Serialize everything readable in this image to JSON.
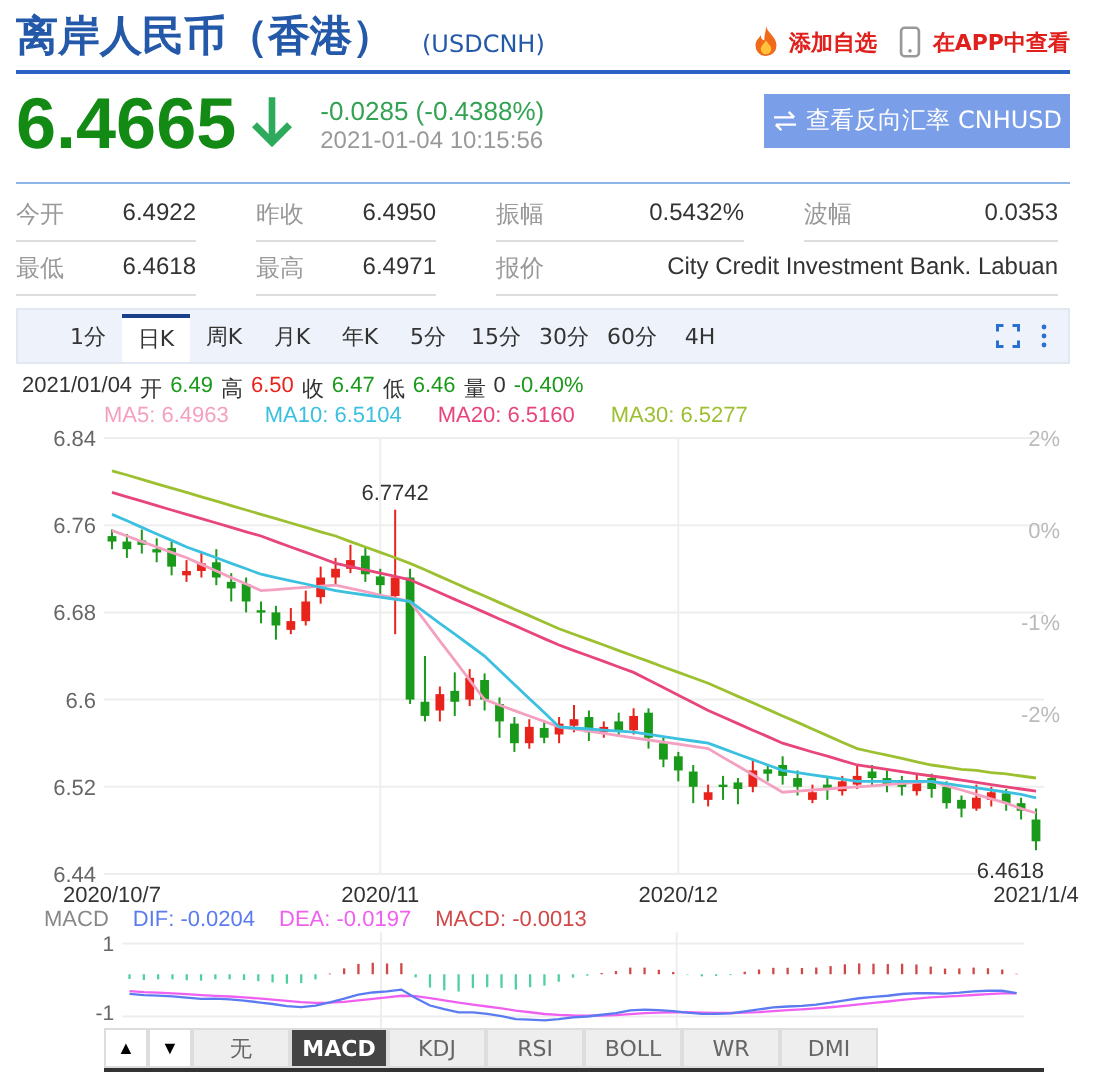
{
  "header": {
    "title": "离岸人民币（香港）",
    "code": "(USDCNH)",
    "actions": [
      {
        "kind": "watch",
        "label": "添加自选"
      },
      {
        "kind": "app",
        "label": "在APP中查看"
      }
    ]
  },
  "quote": {
    "price": "6.4665",
    "falling": true,
    "change": "-0.0285 (-0.4388%)",
    "time": "2021-01-04 10:15:56",
    "reverse_button": "查看反向汇率 CNHUSD"
  },
  "stats": [
    [
      {
        "label": "今开",
        "value": "6.4922"
      },
      {
        "label": "昨收",
        "value": "6.4950"
      },
      {
        "label": "振幅",
        "value": "0.5432%"
      },
      {
        "label": "波幅",
        "value": "0.0353"
      }
    ],
    [
      {
        "label": "最低",
        "value": "6.4618"
      },
      {
        "label": "最高",
        "value": "6.4971"
      },
      {
        "label": "报价",
        "value": "City Credit Investment Bank. Labuan"
      }
    ]
  ],
  "periods": [
    {
      "label": "1分",
      "selected": false
    },
    {
      "label": "日K",
      "selected": true
    },
    {
      "label": "周K",
      "selected": false
    },
    {
      "label": "月K",
      "selected": false
    },
    {
      "label": "年K",
      "selected": false
    },
    {
      "label": "5分",
      "selected": false
    },
    {
      "label": "15分",
      "selected": false
    },
    {
      "label": "30分",
      "selected": false
    },
    {
      "label": "60分",
      "selected": false
    },
    {
      "label": "4H",
      "selected": false
    }
  ],
  "ohlc": {
    "date": "2021/01/04",
    "fields": [
      {
        "label": "开",
        "value": "6.49",
        "color": "#1a9a1a"
      },
      {
        "label": "高",
        "value": "6.50",
        "color": "#e8231b"
      },
      {
        "label": "收",
        "value": "6.47",
        "color": "#1a9a1a"
      },
      {
        "label": "低",
        "value": "6.46",
        "color": "#1a9a1a"
      },
      {
        "label": "量",
        "value": "0",
        "color": "#333333"
      }
    ],
    "change": {
      "text": "-0.40%",
      "color": "#1a9a1a"
    }
  },
  "ma": [
    {
      "text": "MA5: 6.4963",
      "color": "#f4a0c0"
    },
    {
      "text": "MA10: 6.5104",
      "color": "#3cc0e0"
    },
    {
      "text": "MA20: 6.5160",
      "color": "#e8457a"
    },
    {
      "text": "MA30: 6.5277",
      "color": "#9cc030"
    }
  ],
  "chart": {
    "chart_data": {
      "type": "candlestick",
      "ylim": [
        6.44,
        6.84
      ],
      "yticks": [
        6.84,
        6.76,
        6.68,
        6.6,
        6.52,
        6.44
      ],
      "grid": true,
      "categories": [
        "2020/10/7",
        null,
        null,
        null,
        null,
        null,
        null,
        null,
        null,
        null,
        null,
        null,
        null,
        null,
        null,
        null,
        null,
        null,
        "2020/11",
        null,
        null,
        null,
        null,
        null,
        null,
        null,
        null,
        null,
        null,
        null,
        null,
        null,
        null,
        null,
        null,
        null,
        null,
        null,
        "2020/12",
        null,
        null,
        null,
        null,
        null,
        null,
        null,
        null,
        null,
        null,
        null,
        null,
        null,
        null,
        null,
        null,
        null,
        null,
        null,
        null,
        null,
        null,
        null,
        "2021/1/4"
      ],
      "ohlc": [
        [
          6.75,
          6.756,
          6.738,
          6.745
        ],
        [
          6.745,
          6.752,
          6.73,
          6.738
        ],
        [
          6.746,
          6.756,
          6.734,
          6.742
        ],
        [
          6.738,
          6.748,
          6.726,
          6.735
        ],
        [
          6.739,
          6.745,
          6.714,
          6.722
        ],
        [
          6.714,
          6.728,
          6.708,
          6.718
        ],
        [
          6.718,
          6.735,
          6.712,
          6.725
        ],
        [
          6.726,
          6.738,
          6.705,
          6.712
        ],
        [
          6.708,
          6.716,
          6.69,
          6.702
        ],
        [
          6.706,
          6.712,
          6.68,
          6.69
        ],
        [
          6.682,
          6.69,
          6.67,
          6.68
        ],
        [
          6.68,
          6.686,
          6.655,
          6.668
        ],
        [
          6.664,
          6.684,
          6.66,
          6.672
        ],
        [
          6.672,
          6.7,
          6.668,
          6.69
        ],
        [
          6.694,
          6.722,
          6.688,
          6.712
        ],
        [
          6.712,
          6.73,
          6.705,
          6.72
        ],
        [
          6.72,
          6.742,
          6.716,
          6.728
        ],
        [
          6.732,
          6.74,
          6.708,
          6.715
        ],
        [
          6.713,
          6.72,
          6.695,
          6.705
        ],
        [
          6.695,
          6.7742,
          6.66,
          6.712
        ],
        [
          6.712,
          6.72,
          6.596,
          6.6
        ],
        [
          6.598,
          6.64,
          6.58,
          6.585
        ],
        [
          6.59,
          6.612,
          6.58,
          6.605
        ],
        [
          6.608,
          6.625,
          6.585,
          6.598
        ],
        [
          6.6,
          6.628,
          6.594,
          6.62
        ],
        [
          6.618,
          6.624,
          6.59,
          6.6
        ],
        [
          6.596,
          6.602,
          6.565,
          6.58
        ],
        [
          6.578,
          6.584,
          6.552,
          6.56
        ],
        [
          6.56,
          6.582,
          6.555,
          6.575
        ],
        [
          6.574,
          6.58,
          6.56,
          6.565
        ],
        [
          6.568,
          6.584,
          6.56,
          6.578
        ],
        [
          6.576,
          6.595,
          6.57,
          6.582
        ],
        [
          6.584,
          6.59,
          6.562,
          6.57
        ],
        [
          6.57,
          6.58,
          6.565,
          6.575
        ],
        [
          6.58,
          6.588,
          6.566,
          6.572
        ],
        [
          6.572,
          6.592,
          6.568,
          6.585
        ],
        [
          6.588,
          6.592,
          6.555,
          6.565
        ],
        [
          6.56,
          6.566,
          6.538,
          6.545
        ],
        [
          6.548,
          6.552,
          6.525,
          6.535
        ],
        [
          6.534,
          6.54,
          6.505,
          6.52
        ],
        [
          6.508,
          6.522,
          6.502,
          6.515
        ],
        [
          6.522,
          6.53,
          6.508,
          6.52
        ],
        [
          6.524,
          6.528,
          6.504,
          6.518
        ],
        [
          6.52,
          6.545,
          6.515,
          6.535
        ],
        [
          6.536,
          6.54,
          6.525,
          6.532
        ],
        [
          6.54,
          6.548,
          6.522,
          6.53
        ],
        [
          6.528,
          6.535,
          6.512,
          6.52
        ],
        [
          6.508,
          6.522,
          6.505,
          6.515
        ],
        [
          6.522,
          6.528,
          6.508,
          6.518
        ],
        [
          6.516,
          6.53,
          6.512,
          6.525
        ],
        [
          6.522,
          6.54,
          6.518,
          6.53
        ],
        [
          6.534,
          6.54,
          6.52,
          6.528
        ],
        [
          6.528,
          6.535,
          6.515,
          6.522
        ],
        [
          6.526,
          6.53,
          6.512,
          6.52
        ],
        [
          6.516,
          6.532,
          6.512,
          6.525
        ],
        [
          6.528,
          6.532,
          6.51,
          6.518
        ],
        [
          6.52,
          6.525,
          6.5,
          6.505
        ],
        [
          6.508,
          6.512,
          6.492,
          6.5
        ],
        [
          6.5,
          6.522,
          6.498,
          6.51
        ],
        [
          6.508,
          6.52,
          6.502,
          6.515
        ],
        [
          6.514,
          6.518,
          6.498,
          6.505
        ],
        [
          6.505,
          6.51,
          6.49,
          6.498
        ],
        [
          6.49,
          6.5,
          6.4618,
          6.47
        ]
      ],
      "series": [
        {
          "type": "line",
          "color": "#f4a0c0",
          "values": [
            6.755,
            6.75,
            6.745,
            6.74,
            6.735,
            6.73,
            6.724,
            6.718,
            6.712,
            6.706,
            6.7,
            6.701,
            6.702,
            6.703,
            6.704,
            6.705,
            6.702,
            6.699,
            6.696,
            6.693,
            6.69,
            6.672,
            6.654,
            6.636,
            6.618,
            6.6,
            6.595,
            6.59,
            6.585,
            6.58,
            6.575,
            6.573,
            6.571,
            6.569,
            6.567,
            6.565,
            6.563,
            6.561,
            6.559,
            6.557,
            6.555,
            6.547,
            6.539,
            6.531,
            6.523,
            6.515,
            6.516,
            6.517,
            6.518,
            6.519,
            6.52,
            6.521,
            6.522,
            6.523,
            6.524,
            6.525,
            6.521,
            6.517,
            6.513,
            6.509,
            6.505,
            6.5,
            6.496
          ]
        },
        {
          "type": "line",
          "color": "#3cc0e0",
          "values": [
            6.77,
            6.764,
            6.758,
            6.752,
            6.746,
            6.74,
            6.735,
            6.73,
            6.725,
            6.72,
            6.715,
            6.712,
            6.709,
            6.706,
            6.703,
            6.7,
            6.698,
            6.696,
            6.694,
            6.692,
            6.69,
            6.68,
            6.67,
            6.66,
            6.65,
            6.64,
            6.627,
            6.614,
            6.601,
            6.588,
            6.575,
            6.574,
            6.573,
            6.572,
            6.571,
            6.57,
            6.568,
            6.566,
            6.564,
            6.562,
            6.56,
            6.555,
            6.55,
            6.545,
            6.54,
            6.535,
            6.533,
            6.531,
            6.529,
            6.527,
            6.525,
            6.525,
            6.525,
            6.525,
            6.525,
            6.525,
            6.523,
            6.521,
            6.519,
            6.517,
            6.515,
            6.513,
            6.51
          ]
        },
        {
          "type": "line",
          "color": "#e8457a",
          "values": [
            6.79,
            6.786,
            6.782,
            6.778,
            6.774,
            6.77,
            6.766,
            6.762,
            6.758,
            6.754,
            6.75,
            6.745,
            6.74,
            6.735,
            6.73,
            6.725,
            6.722,
            6.719,
            6.716,
            6.713,
            6.71,
            6.704,
            6.698,
            6.692,
            6.686,
            6.68,
            6.674,
            6.668,
            6.662,
            6.656,
            6.65,
            6.645,
            6.64,
            6.635,
            6.63,
            6.625,
            6.618,
            6.611,
            6.604,
            6.597,
            6.59,
            6.584,
            6.578,
            6.572,
            6.566,
            6.56,
            6.556,
            6.552,
            6.548,
            6.544,
            6.54,
            6.538,
            6.536,
            6.534,
            6.532,
            6.53,
            6.528,
            6.526,
            6.524,
            6.522,
            6.52,
            6.518,
            6.516
          ]
        },
        {
          "type": "line",
          "color": "#9cc030",
          "values": [
            6.81,
            6.806,
            6.802,
            6.798,
            6.794,
            6.79,
            6.786,
            6.782,
            6.778,
            6.774,
            6.77,
            6.766,
            6.762,
            6.758,
            6.754,
            6.75,
            6.745,
            6.74,
            6.735,
            6.73,
            6.725,
            6.719,
            6.713,
            6.707,
            6.701,
            6.695,
            6.689,
            6.683,
            6.677,
            6.671,
            6.665,
            6.66,
            6.655,
            6.65,
            6.645,
            6.64,
            6.635,
            6.63,
            6.625,
            6.62,
            6.615,
            6.609,
            6.603,
            6.597,
            6.591,
            6.585,
            6.579,
            6.573,
            6.567,
            6.561,
            6.555,
            6.552,
            6.549,
            6.546,
            6.543,
            6.54,
            6.538,
            6.536,
            6.535,
            6.533,
            6.532,
            6.53,
            6.528
          ]
        }
      ]
    },
    "pct_labels": [
      "2%",
      "0%",
      "-1%",
      "-2%"
    ],
    "high_label": "6.7742",
    "low_label": "6.4618"
  },
  "macd": {
    "legend": [
      {
        "text": "MACD",
        "color": "#888888"
      },
      {
        "text": "DIF: -0.0204",
        "color": "#5a7cf0"
      },
      {
        "text": "DEA: -0.0197",
        "color": "#f060f0"
      },
      {
        "text": "MACD: -0.0013",
        "color": "#d04848"
      }
    ],
    "y_labels": [
      "1",
      "-1"
    ]
  },
  "arrows": [
    "▲",
    "▼"
  ],
  "indicators": [
    {
      "label": "无",
      "selected": false
    },
    {
      "label": "MACD",
      "selected": true
    },
    {
      "label": "KDJ",
      "selected": false
    },
    {
      "label": "RSI",
      "selected": false
    },
    {
      "label": "BOLL",
      "selected": false
    },
    {
      "label": "WR",
      "selected": false
    },
    {
      "label": "DMI",
      "selected": false
    }
  ]
}
